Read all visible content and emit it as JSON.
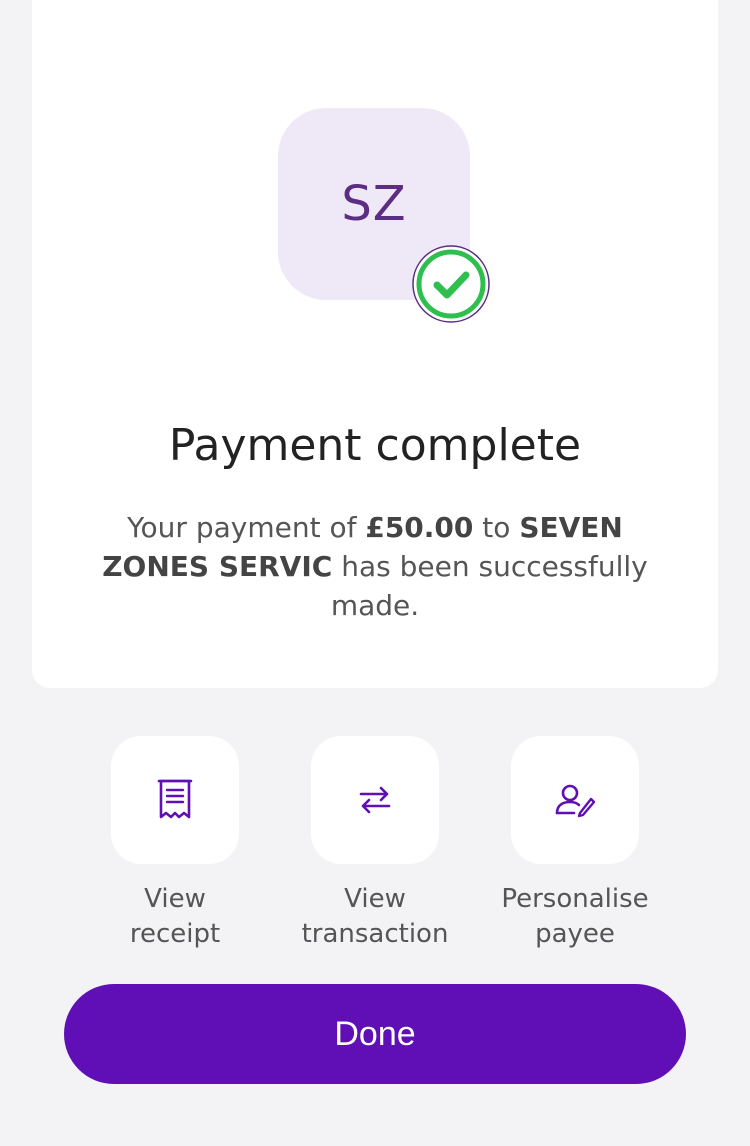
{
  "payee": {
    "initials": "SZ"
  },
  "status": {
    "title": "Payment complete",
    "message_prefix": "Your payment of ",
    "amount": "£50.00",
    "message_to": " to ",
    "payee_name": "SEVEN ZONES SERVIC",
    "message_suffix": " has been successfully made."
  },
  "actions": [
    {
      "label_line1": "View",
      "label_line2": "receipt",
      "icon": "receipt-icon"
    },
    {
      "label_line1": "View",
      "label_line2": "transaction",
      "icon": "transfer-arrows-icon"
    },
    {
      "label_line1": "Personalise",
      "label_line2": "payee",
      "icon": "edit-person-icon"
    }
  ],
  "done_button": {
    "label": "Done"
  },
  "colors": {
    "primary": "#5f0fb5",
    "avatar_bg": "#efe9f7",
    "success": "#2fbf4f"
  }
}
